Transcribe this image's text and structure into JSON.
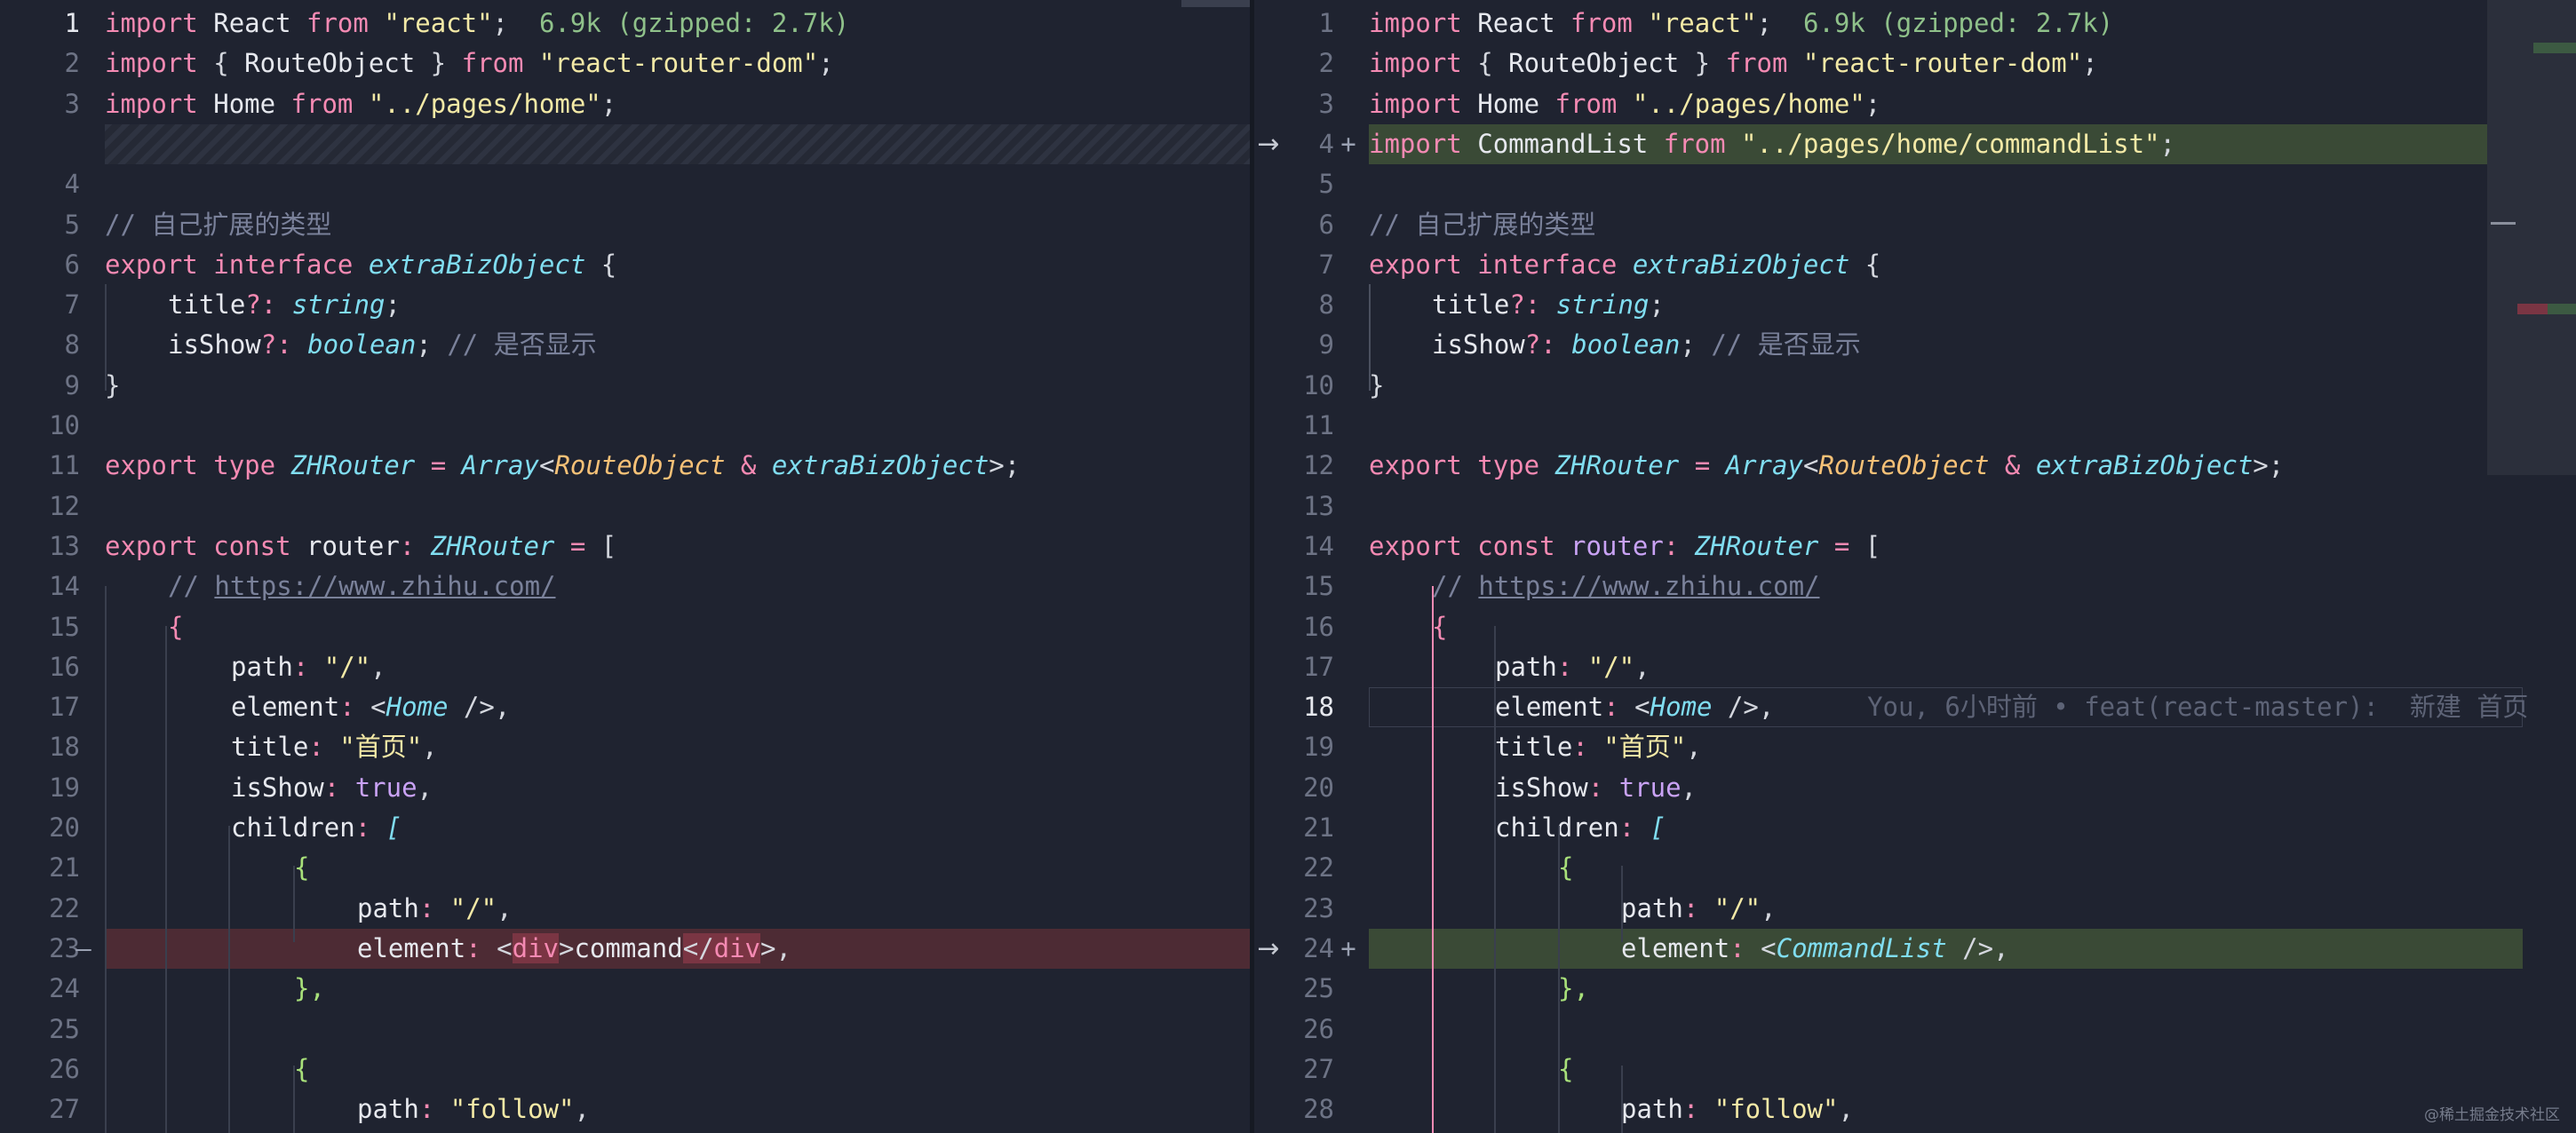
{
  "size_hint": "6.9k (gzipped: 2.7k)",
  "blame": "You, 6小时前 • feat(react-master):  新建 首页",
  "watermark": "@稀土掘金技术社区",
  "left": {
    "nums": [
      "1",
      "2",
      "3",
      "",
      "4",
      "5",
      "6",
      "7",
      "8",
      "9",
      "10",
      "11",
      "12",
      "13",
      "14",
      "15",
      "16",
      "17",
      "18",
      "19",
      "20",
      "21",
      "22",
      "23",
      "24",
      "25",
      "26",
      "27"
    ],
    "del_marker": "—"
  },
  "right": {
    "nums": [
      "1",
      "2",
      "3",
      "4",
      "5",
      "6",
      "7",
      "8",
      "9",
      "10",
      "11",
      "12",
      "13",
      "14",
      "15",
      "16",
      "17",
      "18",
      "19",
      "20",
      "21",
      "22",
      "23",
      "24",
      "25",
      "26",
      "27",
      "28"
    ],
    "add_marker": "+"
  },
  "arrow": "→",
  "tokens": {
    "import": "import",
    "from": "from",
    "export": "export",
    "interface": "interface",
    "type": "type",
    "const": "const",
    "React": "React",
    "react_str": "\"react\"",
    "semi": ";",
    "lbrace_sp": "{ ",
    "RouteObject": "RouteObject",
    "sp_rbrace": " }",
    "rrd_str": "\"react-router-dom\"",
    "Home": "Home",
    "home_str": "\"../pages/home\"",
    "CommandList": "CommandList",
    "cl_str": "\"../pages/home/commandList\"",
    "cmt_ext": "// 自己扩展的类型",
    "extraBizObject": "extraBizObject",
    "lbrace": "{",
    "rbrace": "}",
    "title_opt": "title",
    "qcolon": "?: ",
    "string": "string",
    "isShow_opt": "isShow",
    "boolean": "boolean",
    "cmt_show": "// 是否显示",
    "ZHRouter": "ZHRouter",
    "eq": " = ",
    "Array": "Array",
    "lt": "<",
    "gt": ">",
    "amp": " & ",
    "router": "router",
    "colon": ": ",
    "lbracket": "[",
    "cmt_slash": "// ",
    "url": "https://www.zhihu.com/",
    "path": "path",
    "slash_str": "\"/\"",
    "comma": ",",
    "element": "element",
    "lt_sp": "<",
    "sp_selfclose": " />",
    "title": "title",
    "home_cn": "\"首页\"",
    "isShow": "isShow",
    "true": "true",
    "children": "children",
    "rbrace_comma": "},",
    "div": "div",
    "command": "command",
    "close_lt": "</",
    "follow_str": "\"follow\""
  }
}
